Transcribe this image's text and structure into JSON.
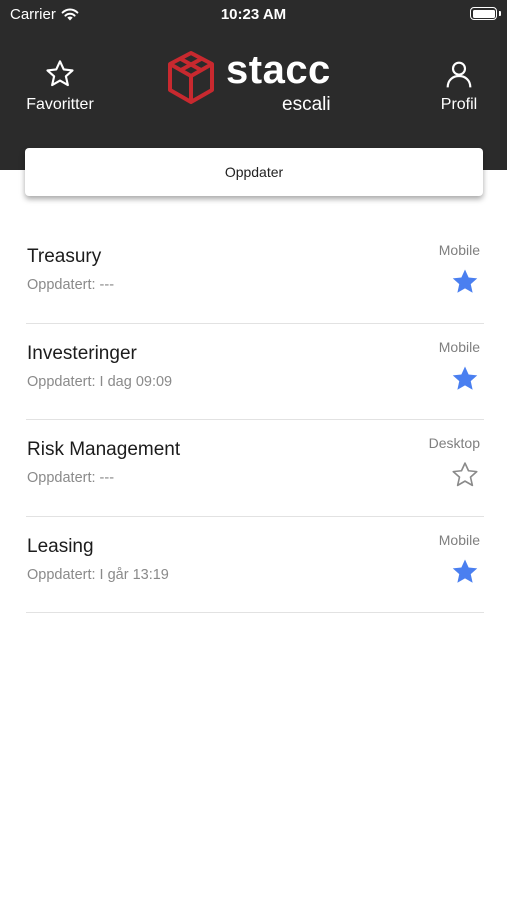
{
  "status_bar": {
    "carrier": "Carrier",
    "time": "10:23 AM"
  },
  "header": {
    "favorites_label": "Favoritter",
    "profile_label": "Profil",
    "logo_text": "stacc",
    "logo_subtext": "escali"
  },
  "update_button": {
    "label": "Oppdater"
  },
  "colors": {
    "header_bg": "#2b2b2b",
    "accent_star": "#4a7ff0",
    "logo_red": "#c8292f"
  },
  "items": [
    {
      "title": "Treasury",
      "updated": "Oppdatert: ---",
      "platform": "Mobile",
      "favorite": true
    },
    {
      "title": "Investeringer",
      "updated": "Oppdatert: I dag 09:09",
      "platform": "Mobile",
      "favorite": true
    },
    {
      "title": "Risk Management",
      "updated": "Oppdatert: ---",
      "platform": "Desktop",
      "favorite": false
    },
    {
      "title": "Leasing",
      "updated": "Oppdatert: I går 13:19",
      "platform": "Mobile",
      "favorite": true
    }
  ]
}
